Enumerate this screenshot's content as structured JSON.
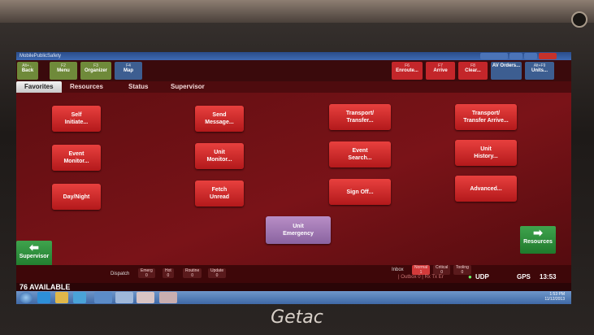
{
  "window": {
    "title": "MobilePublicSafety"
  },
  "toolbar": {
    "left": [
      {
        "key": "Alt+←",
        "label": "Back"
      },
      {
        "key": "F2",
        "label": "Menu"
      },
      {
        "key": "F3",
        "label": "Organizer"
      },
      {
        "key": "F4",
        "label": "Map"
      }
    ],
    "right": [
      {
        "key": "F6",
        "label": "Enroute..."
      },
      {
        "key": "F7",
        "label": "Arrive"
      },
      {
        "key": "F8",
        "label": "Clear..."
      },
      {
        "key": "",
        "label": "AV Orders..."
      },
      {
        "key": "Alt+F9",
        "label": "Units..."
      }
    ]
  },
  "tabs": [
    "Favorites",
    "Resources",
    "Status",
    "Supervisor"
  ],
  "buttons": [
    "Self\nInitiate...",
    "Send\nMessage...",
    "Transport/\nTransfer...",
    "Transport/\nTransfer Arrive...",
    "Event\nMonitor...",
    "Unit\nMonitor...",
    "Event\nSearch...",
    "Unit\nHistory...",
    "Day/Night",
    "Fetch\nUnread",
    "Sign Off...",
    "Advanced..."
  ],
  "emergency": "Unit\nEmergency",
  "nav": {
    "left": "Supervisor",
    "right": "Resources"
  },
  "status": {
    "dispatch": "Dispatch",
    "dispatch_counts": [
      {
        "label": "Emerg",
        "count": "0"
      },
      {
        "label": "Hot",
        "count": "0"
      },
      {
        "label": "Routine",
        "count": "0"
      },
      {
        "label": "Update",
        "count": "0"
      }
    ],
    "inbox": "Inbox",
    "inbox_counts": [
      {
        "label": "Normal",
        "count": "1"
      },
      {
        "label": "Critical",
        "count": "0"
      },
      {
        "label": "Tooling",
        "count": "0"
      }
    ],
    "outbox": "| Outbox 0 | Rx Tx Er",
    "udp": "UDP",
    "gps": "GPS",
    "time": "13:53"
  },
  "unit_status": "76  AVAILABLE",
  "clock": {
    "time": "1:53 PM",
    "date": "11/12/2013"
  },
  "bezel_logo": "Getac",
  "colors": {
    "accent_red": "#d42a2b",
    "emergency_purple": "#a27bb5",
    "nav_green": "#2f8f3c"
  }
}
